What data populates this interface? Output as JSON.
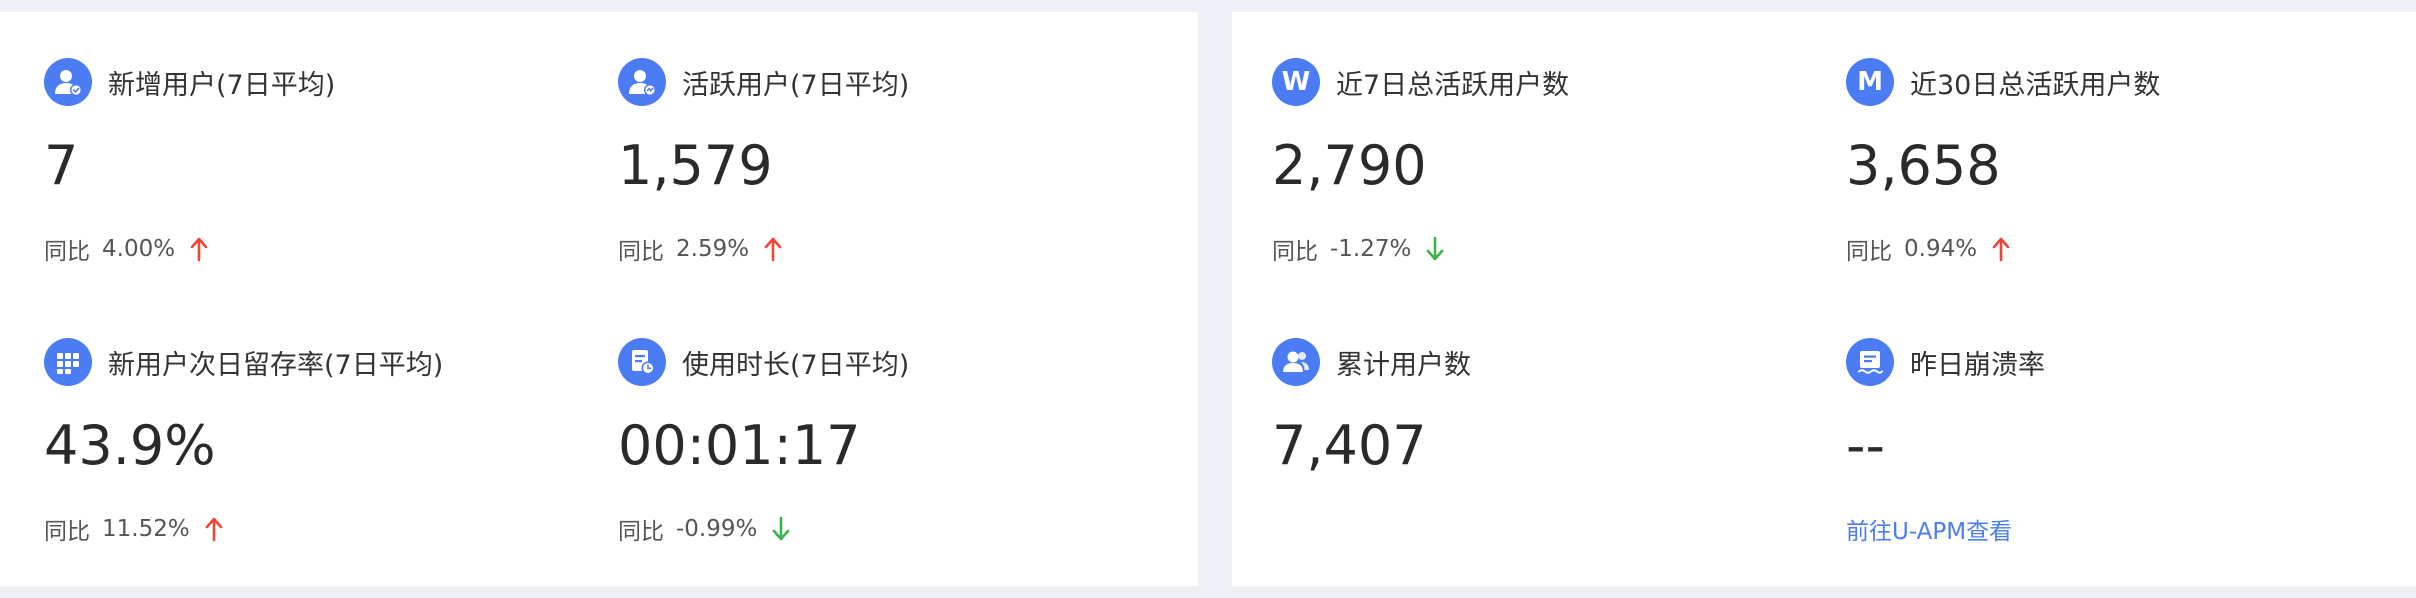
{
  "colors": {
    "accent": "#4b7cf3",
    "up": "#f04437",
    "down": "#3cb34a",
    "background": "#eef0f5",
    "panel": "#ffffff"
  },
  "left_panel": {
    "cards": [
      {
        "icon": "user-check-icon",
        "title": "新增用户(7日平均)",
        "value": "7",
        "compare_label": "同比",
        "compare_value": "4.00%",
        "trend": "up"
      },
      {
        "icon": "user-active-icon",
        "title": "活跃用户(7日平均)",
        "value": "1,579",
        "compare_label": "同比",
        "compare_value": "2.59%",
        "trend": "up"
      },
      {
        "icon": "grid-apps-icon",
        "title": "新用户次日留存率(7日平均)",
        "value": "43.9%",
        "compare_label": "同比",
        "compare_value": "11.52%",
        "trend": "up"
      },
      {
        "icon": "clock-document-icon",
        "title": "使用时长(7日平均)",
        "value": "00:01:17",
        "compare_label": "同比",
        "compare_value": "-0.99%",
        "trend": "down"
      }
    ]
  },
  "right_panel": {
    "cards": [
      {
        "icon": "letter-w-icon",
        "icon_letter": "W",
        "title": "近7日总活跃用户数",
        "value": "2,790",
        "compare_label": "同比",
        "compare_value": "-1.27%",
        "trend": "down"
      },
      {
        "icon": "letter-m-icon",
        "icon_letter": "M",
        "title": "近30日总活跃用户数",
        "value": "3,658",
        "compare_label": "同比",
        "compare_value": "0.94%",
        "trend": "up"
      },
      {
        "icon": "users-group-icon",
        "title": "累计用户数",
        "value": "7,407"
      },
      {
        "icon": "crash-report-icon",
        "title": "昨日崩溃率",
        "value": "--",
        "link_text": "前往U-APM查看"
      }
    ]
  }
}
